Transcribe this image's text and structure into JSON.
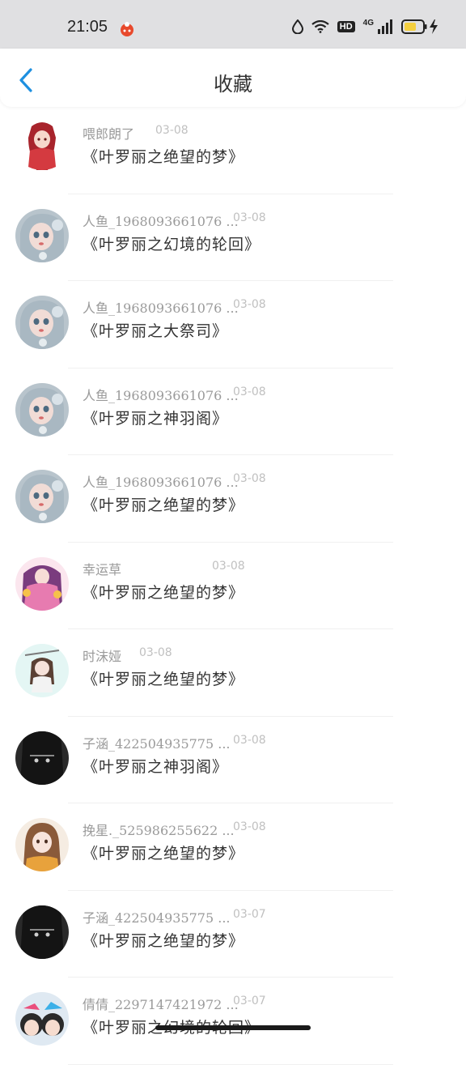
{
  "status_bar": {
    "time": "21:05",
    "network_label": "4G",
    "hd_label": "HD",
    "icons": [
      "app-notification-icon",
      "dnd-drop-icon",
      "wifi-icon",
      "hd-icon",
      "signal-icon",
      "battery-icon",
      "charging-icon"
    ],
    "battery_color": "#f5d040"
  },
  "header": {
    "title": "收藏",
    "back_icon": "chevron-left-icon",
    "accent_color": "#1e90e0"
  },
  "favorites": [
    {
      "author": "喂郎朗了",
      "date": "03-08",
      "book": "《叶罗丽之绝望的梦》",
      "avatar": "avatar-girl-red-icon"
    },
    {
      "author": "人鱼_1968093661076 ...",
      "date": "03-08",
      "book": "《叶罗丽之幻境的轮回》",
      "avatar": "avatar-doll-blue-icon"
    },
    {
      "author": "人鱼_1968093661076 ...",
      "date": "03-08",
      "book": "《叶罗丽之大祭司》",
      "avatar": "avatar-doll-blue-icon"
    },
    {
      "author": "人鱼_1968093661076 ...",
      "date": "03-08",
      "book": "《叶罗丽之神羽阁》",
      "avatar": "avatar-doll-blue-icon"
    },
    {
      "author": "人鱼_1968093661076 ...",
      "date": "03-08",
      "book": "《叶罗丽之绝望的梦》",
      "avatar": "avatar-doll-blue-icon"
    },
    {
      "author": "幸运草",
      "date": "03-08",
      "book": "《叶罗丽之绝望的梦》",
      "avatar": "avatar-girl-pink-icon"
    },
    {
      "author": "时沫娅",
      "date": "03-08",
      "book": "《叶罗丽之绝望的梦》",
      "avatar": "avatar-chibi-icon"
    },
    {
      "author": "子涵_422504935775 ...",
      "date": "03-08",
      "book": "《叶罗丽之神羽阁》",
      "avatar": "avatar-dark-outfit-icon"
    },
    {
      "author": "挽星._525986255622 ...",
      "date": "03-08",
      "book": "《叶罗丽之绝望的梦》",
      "avatar": "avatar-girl-brown-hair-icon"
    },
    {
      "author": "子涵_422504935775 ...",
      "date": "03-07",
      "book": "《叶罗丽之绝望的梦》",
      "avatar": "avatar-dark-outfit-icon"
    },
    {
      "author": "倩倩_2297147421972 ...",
      "date": "03-07",
      "book": "《叶罗丽之幻境的轮回》",
      "avatar": "avatar-two-kids-icon"
    }
  ]
}
